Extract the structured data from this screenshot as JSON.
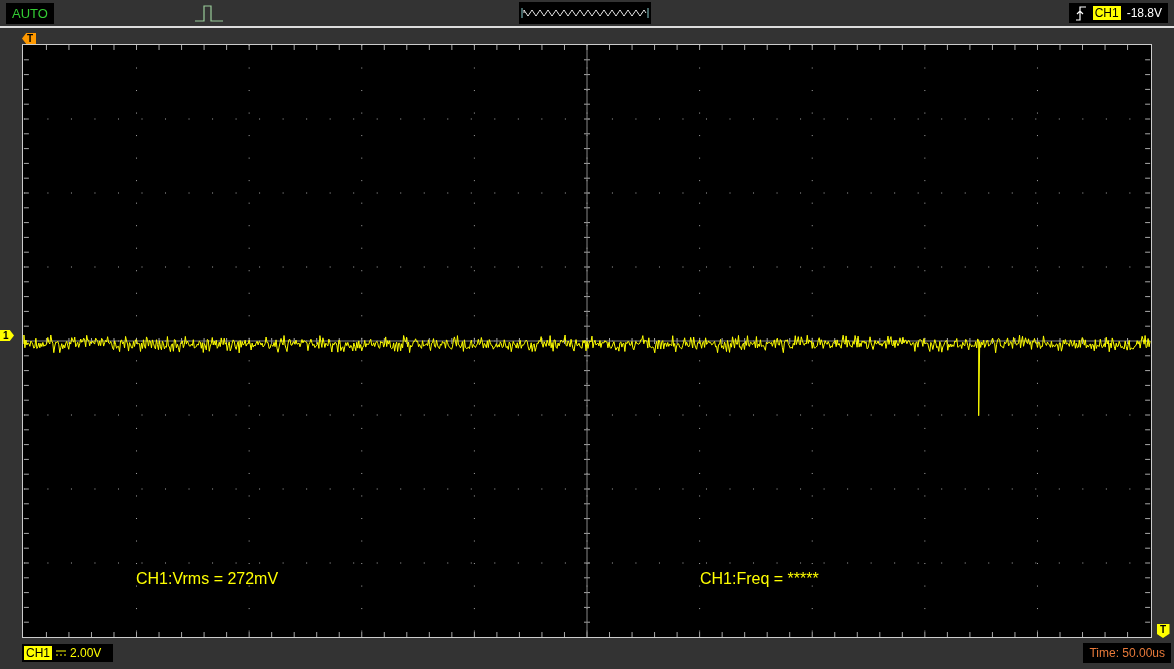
{
  "mode": "AUTO",
  "trigger": {
    "source": "CH1",
    "level": "-18.8V"
  },
  "markers": {
    "trigger_position": "T",
    "channel": "1",
    "trigger_level": "T"
  },
  "measurements": [
    {
      "text": "CH1:Vrms = 272mV"
    },
    {
      "text": "CH1:Freq = *****"
    }
  ],
  "channel_scale": {
    "channel": "CH1",
    "volts": "2.00V"
  },
  "timebase": "Time: 50.00us"
}
